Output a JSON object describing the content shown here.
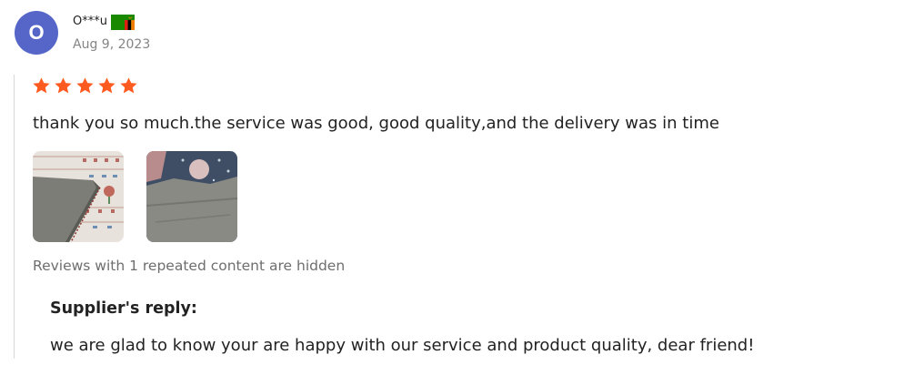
{
  "reviewer": {
    "avatar_letter": "O",
    "name": "O***u",
    "flag": "zambia-flag",
    "date": "Aug 9, 2023"
  },
  "review": {
    "rating": 5,
    "rating_max": 5,
    "star_color": "#ff5a1f",
    "text": "thank you so much.the service was good, good quality,and the delivery was in time",
    "photos": [
      {
        "name": "review-photo-1"
      },
      {
        "name": "review-photo-2"
      }
    ],
    "hidden_note": "Reviews with 1 repeated content are hidden"
  },
  "supplier_reply": {
    "title": "Supplier's reply:",
    "text": "we are glad to know your are happy with our service and product quality, dear friend!"
  },
  "colors": {
    "avatar_bg": "#5566c8",
    "flag_green": "#198a00",
    "flag_red": "#de2010",
    "flag_black": "#000000",
    "flag_orange": "#ef7d00"
  }
}
